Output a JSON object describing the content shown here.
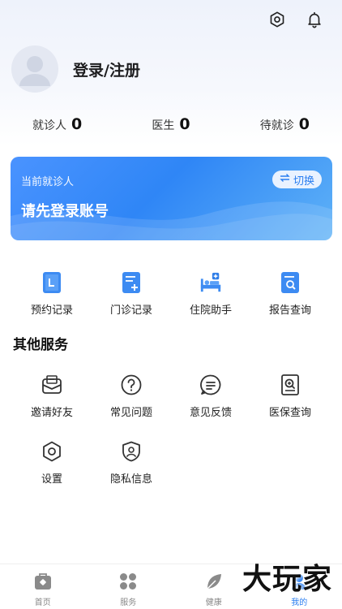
{
  "header": {
    "login_label": "登录/注册",
    "icons": [
      "settings-hexagon-icon",
      "bell-icon"
    ]
  },
  "stats": [
    {
      "label": "就诊人",
      "value": "0"
    },
    {
      "label": "医生",
      "value": "0"
    },
    {
      "label": "待就诊",
      "value": "0"
    }
  ],
  "patient_card": {
    "current_label": "当前就诊人",
    "hint": "请先登录账号",
    "switch_label": "切换",
    "accent": "#2f86f6"
  },
  "quick_actions": [
    {
      "label": "预约记录",
      "icon": "appointment-record-icon"
    },
    {
      "label": "门诊记录",
      "icon": "outpatient-record-icon"
    },
    {
      "label": "住院助手",
      "icon": "hospital-bed-icon"
    },
    {
      "label": "报告查询",
      "icon": "report-search-icon"
    }
  ],
  "other_services": {
    "title": "其他服务",
    "items": [
      {
        "label": "邀请好友",
        "icon": "invite-mail-icon"
      },
      {
        "label": "常见问题",
        "icon": "question-icon"
      },
      {
        "label": "意见反馈",
        "icon": "feedback-icon"
      },
      {
        "label": "医保查询",
        "icon": "insurance-search-icon"
      },
      {
        "label": "设置",
        "icon": "settings-icon"
      },
      {
        "label": "隐私信息",
        "icon": "privacy-shield-icon"
      }
    ]
  },
  "tabbar": {
    "active_color": "#2a7ef0",
    "tabs": [
      {
        "label": "首页",
        "icon": "home-medical-bag-icon"
      },
      {
        "label": "服务",
        "icon": "grid-apps-icon"
      },
      {
        "label": "健康",
        "icon": "leaf-icon"
      },
      {
        "label": "我的",
        "icon": "profile-icon",
        "active": true
      }
    ]
  },
  "watermark": "大玩家"
}
